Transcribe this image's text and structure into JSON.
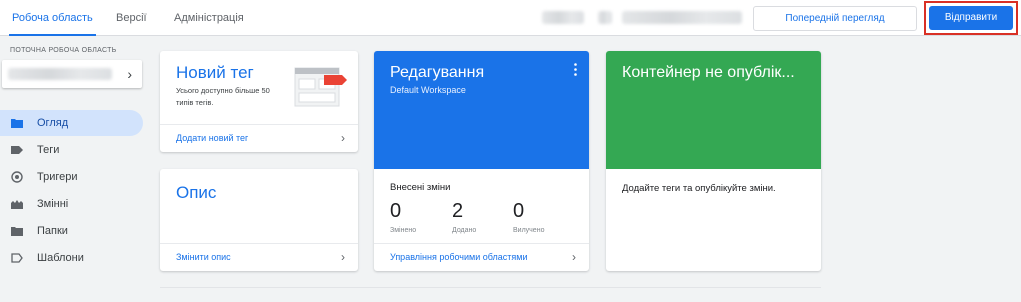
{
  "topbar": {
    "tabs": [
      {
        "label": "Робоча область",
        "active": true
      },
      {
        "label": "Версії",
        "active": false
      },
      {
        "label": "Адміністрація",
        "active": false
      }
    ],
    "preview_label": "Попередній перегляд",
    "submit_label": "Відправити"
  },
  "sidebar": {
    "workspace_caption": "ПОТОЧНА РОБОЧА ОБЛАСТЬ",
    "items": [
      {
        "label": "Огляд",
        "icon": "folder-icon",
        "active": true
      },
      {
        "label": "Теги",
        "icon": "tag-icon",
        "active": false
      },
      {
        "label": "Тригери",
        "icon": "trigger-icon",
        "active": false
      },
      {
        "label": "Змінні",
        "icon": "variables-icon",
        "active": false
      },
      {
        "label": "Папки",
        "icon": "folder-icon",
        "active": false
      },
      {
        "label": "Шаблони",
        "icon": "template-icon",
        "active": false
      }
    ]
  },
  "new_tag_card": {
    "title": "Новий тег",
    "description": "Усього доступно більше 50 типів тегів.",
    "footer_link": "Додати новий тег"
  },
  "description_card": {
    "title": "Опис",
    "footer_link": "Змінити опис"
  },
  "editing_card": {
    "title": "Редагування",
    "subtitle": "Default Workspace",
    "changes_heading": "Внесені зміни",
    "stats": [
      {
        "value": "0",
        "label": "Змінено"
      },
      {
        "value": "2",
        "label": "Додано"
      },
      {
        "value": "0",
        "label": "Вилучено"
      }
    ],
    "footer_link": "Управління робочими областями",
    "header_color": "#1a73e8"
  },
  "container_card": {
    "title": "Контейнер не опублік...",
    "body": "Додайте теги та опублікуйте зміни.",
    "header_color": "#34a853"
  }
}
